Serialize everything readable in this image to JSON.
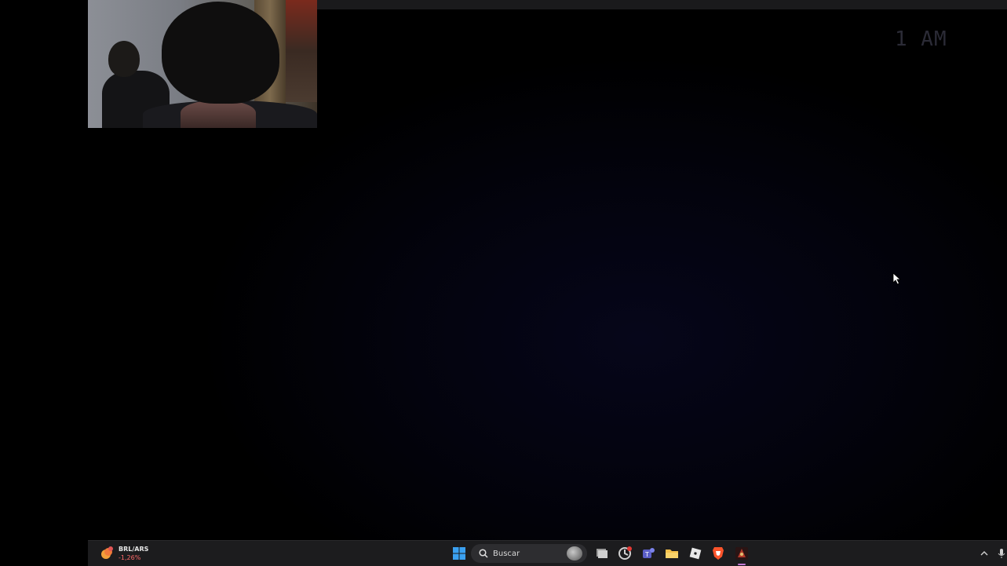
{
  "screen": {
    "clock_text": "1 AM"
  },
  "webcam": {
    "label": "webcam-overlay"
  },
  "taskbar": {
    "widget": {
      "pair": "BRL/ARS",
      "change": "-1,26%",
      "icon": "currency-exchange-icon"
    },
    "search": {
      "label": "Buscar",
      "icon": "search-icon"
    },
    "apps": [
      {
        "name": "Start",
        "icon": "windows-start-icon"
      },
      {
        "name": "Task View",
        "icon": "task-view-icon"
      },
      {
        "name": "Chrome-like app",
        "icon": "circular-app-icon"
      },
      {
        "name": "Teams",
        "icon": "teams-icon"
      },
      {
        "name": "File Explorer",
        "icon": "folder-icon"
      },
      {
        "name": "Roblox",
        "icon": "roblox-icon"
      },
      {
        "name": "Brave",
        "icon": "brave-icon"
      },
      {
        "name": "Game",
        "icon": "game-app-icon"
      }
    ],
    "tray": {
      "chevron": "chevron-up-icon",
      "mic": "microphone-icon"
    }
  },
  "colors": {
    "taskbar_bg": "#1c1c1e",
    "accent_active": "#c27ad6",
    "widget_change_color": "#ff6b6b"
  }
}
